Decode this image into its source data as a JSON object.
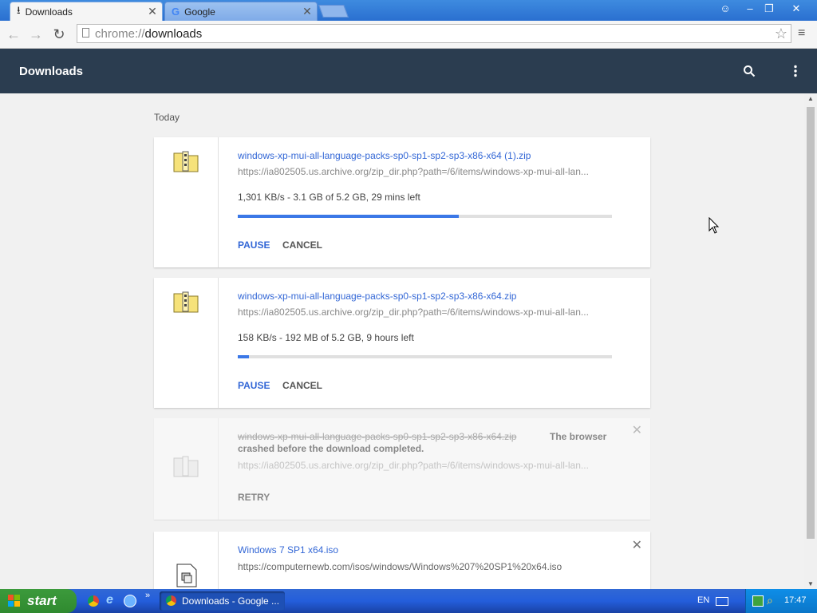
{
  "browser": {
    "tabs": [
      {
        "label": "Downloads",
        "active": true
      },
      {
        "label": "Google",
        "active": false
      }
    ],
    "url_scheme": "chrome://",
    "url_path": "downloads"
  },
  "app": {
    "title": "Downloads"
  },
  "section_label": "Today",
  "downloads": [
    {
      "filename": "windows-xp-mui-all-language-packs-sp0-sp1-sp2-sp3-x86-x64 (1).zip",
      "url": "https://ia802505.us.archive.org/zip_dir.php?path=/6/items/windows-xp-mui-all-lan...",
      "status": "1,301 KB/s - 3.1 GB of 5.2 GB, 29 mins left",
      "progress": 0.59,
      "pause_label": "PAUSE",
      "cancel_label": "CANCEL"
    },
    {
      "filename": "windows-xp-mui-all-language-packs-sp0-sp1-sp2-sp3-x86-x64.zip",
      "url": "https://ia802505.us.archive.org/zip_dir.php?path=/6/items/windows-xp-mui-all-lan...",
      "status": "158 KB/s - 192 MB of 5.2 GB, 9 hours left",
      "progress": 0.03,
      "pause_label": "PAUSE",
      "cancel_label": "CANCEL"
    },
    {
      "filename": "windows-xp-mui-all-language-packs-sp0-sp1-sp2-sp3-x86-x64.zip",
      "error_line1": "The browser",
      "error_line2": "crashed before the download completed.",
      "url": "https://ia802505.us.archive.org/zip_dir.php?path=/6/items/windows-xp-mui-all-lan...",
      "retry_label": "RETRY"
    },
    {
      "filename": "Windows 7 SP1 x64.iso",
      "url": "https://computernewb.com/isos/windows/Windows%207%20SP1%20x64.iso"
    }
  ],
  "taskbar": {
    "start_label": "start",
    "window_label": "Downloads - Google ...",
    "language": "EN",
    "clock": "17:47"
  },
  "colors": {
    "appbar": "#2b3d50",
    "link": "#3367d6",
    "progress": "#3b78e7"
  }
}
